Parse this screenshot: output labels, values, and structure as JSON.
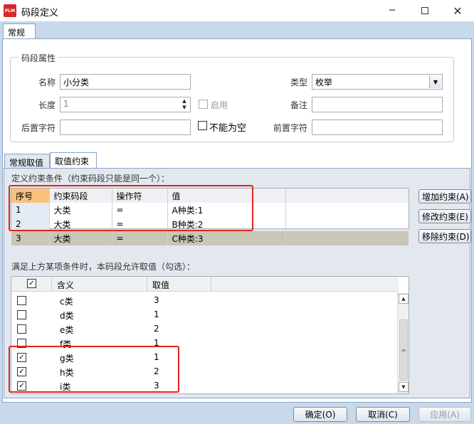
{
  "window": {
    "title": "码段定义",
    "logo_text": "PLM",
    "minimize_icon": "minimize-icon",
    "maximize_icon": "maximize-icon",
    "close_icon": "close-icon"
  },
  "main_tab": {
    "label": "常规"
  },
  "attributes": {
    "legend": "码段属性",
    "name": {
      "label": "名称",
      "value": "小分类"
    },
    "type": {
      "label": "类型",
      "value": "枚举"
    },
    "length": {
      "label": "长度",
      "value": "1"
    },
    "enable": {
      "label": "启用",
      "checked": false
    },
    "remark": {
      "label": "备注",
      "value": ""
    },
    "suffix": {
      "label": "后置字符",
      "value": ""
    },
    "not_null": {
      "label": "不能为空",
      "checked": false
    },
    "prefix": {
      "label": "前置字符",
      "value": ""
    }
  },
  "sub_tabs": [
    {
      "label": "常规取值"
    },
    {
      "label": "取值约束"
    }
  ],
  "constraints": {
    "caption": "定义约束条件（约束码段只能是同一个）：",
    "headers": [
      "序号",
      "约束码段",
      "操作符",
      "值"
    ],
    "rows": [
      {
        "no": "1",
        "segment": "大类",
        "op": "=",
        "value": "A种类:1"
      },
      {
        "no": "2",
        "segment": "大类",
        "op": "=",
        "value": "B种类:2"
      },
      {
        "no": "3",
        "segment": "大类",
        "op": "=",
        "value": "C种类:3"
      }
    ],
    "buttons": {
      "add": "增加约束(A)",
      "edit": "修改约束(E)",
      "remove": "移除约束(D)"
    }
  },
  "allowed": {
    "caption": "满足上方某项条件时，本码段允许取值（勾选）：",
    "headers": [
      "含义",
      "取值"
    ],
    "header_checked": true,
    "rows": [
      {
        "checked": false,
        "meaning": "c类",
        "value": "3"
      },
      {
        "checked": false,
        "meaning": "d类",
        "value": "1"
      },
      {
        "checked": false,
        "meaning": "e类",
        "value": "2"
      },
      {
        "checked": false,
        "meaning": "f类",
        "value": "1"
      },
      {
        "checked": true,
        "meaning": "g类",
        "value": "1"
      },
      {
        "checked": true,
        "meaning": "h类",
        "value": "2"
      },
      {
        "checked": true,
        "meaning": "i类",
        "value": "3"
      }
    ]
  },
  "footer": {
    "ok": "确定(O)",
    "cancel": "取消(C)",
    "apply": "应用(A)"
  },
  "colors": {
    "accent_red": "#e0261c",
    "client_bg": "#c9d9ec",
    "header_orange": "#f9c27c",
    "selected_row": "#c9c6b5"
  }
}
